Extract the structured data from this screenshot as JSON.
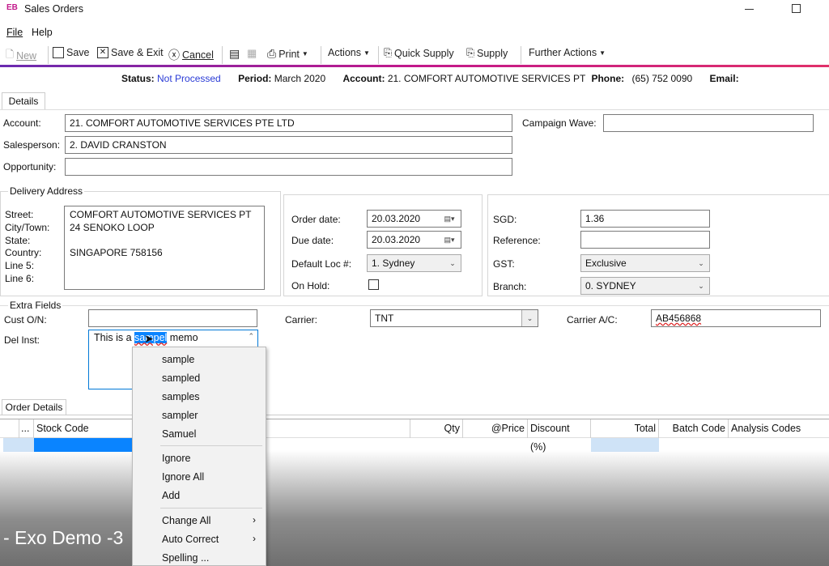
{
  "window": {
    "logo": "EB",
    "title": "Sales Orders",
    "minimize_icon": "minimize-icon",
    "maximize_icon": "maximize-icon"
  },
  "menu": [
    "File",
    "Help"
  ],
  "toolbar": {
    "new": "New",
    "save": "Save",
    "save_exit": "Save & Exit",
    "cancel": "Cancel",
    "print": "Print",
    "actions": "Actions",
    "quick_supply": "Quick Supply",
    "supply": "Supply",
    "further_actions": "Further Actions"
  },
  "status": {
    "status_label": "Status:",
    "status_value": "Not Processed",
    "period_label": "Period:",
    "period_value": "March 2020",
    "account_label": "Account:",
    "account_value": "21. COMFORT AUTOMOTIVE SERVICES PT",
    "phone_label": "Phone:",
    "phone_value": "(65) 752 0090",
    "email_label": "Email:"
  },
  "tabs": {
    "details": "Details",
    "order_details": "Order Details"
  },
  "details": {
    "account_label": "Account:",
    "account": "21. COMFORT AUTOMOTIVE SERVICES PTE LTD",
    "campaign_label": "Campaign Wave:",
    "campaign": "",
    "salesperson_label": "Salesperson:",
    "salesperson": "2. DAVID CRANSTON",
    "opportunity_label": "Opportunity:",
    "opportunity": ""
  },
  "delivery": {
    "title": "Delivery Address",
    "labels": [
      "Street:",
      "City/Town:",
      "State:",
      "Country:",
      "Line 5:",
      "Line 6:"
    ],
    "lines": [
      "COMFORT AUTOMOTIVE SERVICES PT",
      "24 SENOKO LOOP",
      "",
      "SINGAPORE 758156",
      "",
      ""
    ]
  },
  "dates": {
    "order_label": "Order date:",
    "order": "20.03.2020",
    "due_label": "Due date:",
    "due": "20.03.2020",
    "loc_label": "Default Loc #:",
    "loc": "1. Sydney",
    "hold_label": "On Hold:",
    "on_hold": false
  },
  "finance": {
    "currency_label": "SGD:",
    "rate": "1.36",
    "reference_label": "Reference:",
    "reference": "",
    "gst_label": "GST:",
    "gst": "Exclusive",
    "branch_label": "Branch:",
    "branch": "0. SYDNEY"
  },
  "extra": {
    "title": "Extra Fields",
    "cust_label": "Cust O/N:",
    "cust": "",
    "carrier_label": "Carrier:",
    "carrier": "TNT",
    "carrier_ac_label": "Carrier A/C:",
    "carrier_ac": "AB456868",
    "del_inst_label": "Del Inst:",
    "memo_before": "This is a ",
    "memo_selected": "sampel",
    "memo_after": " memo"
  },
  "context_menu": {
    "suggestions": [
      "sample",
      "sampled",
      "samples",
      "sampler",
      "Samuel"
    ],
    "actions": [
      "Ignore",
      "Ignore All",
      "Add"
    ],
    "submenus": [
      "Change All",
      "Auto Correct"
    ],
    "spelling": "Spelling ..."
  },
  "grid": {
    "columns": [
      "...",
      "Stock Code",
      "Qty",
      "@Price",
      "Discount (%)",
      "Total",
      "Batch Code",
      "Analysis Codes"
    ]
  },
  "overlay": {
    "caption": "- Exo Demo -3"
  },
  "colors": {
    "accent": "#c2188b",
    "status_link": "#2a3bd6",
    "selection": "#0a84ff"
  }
}
